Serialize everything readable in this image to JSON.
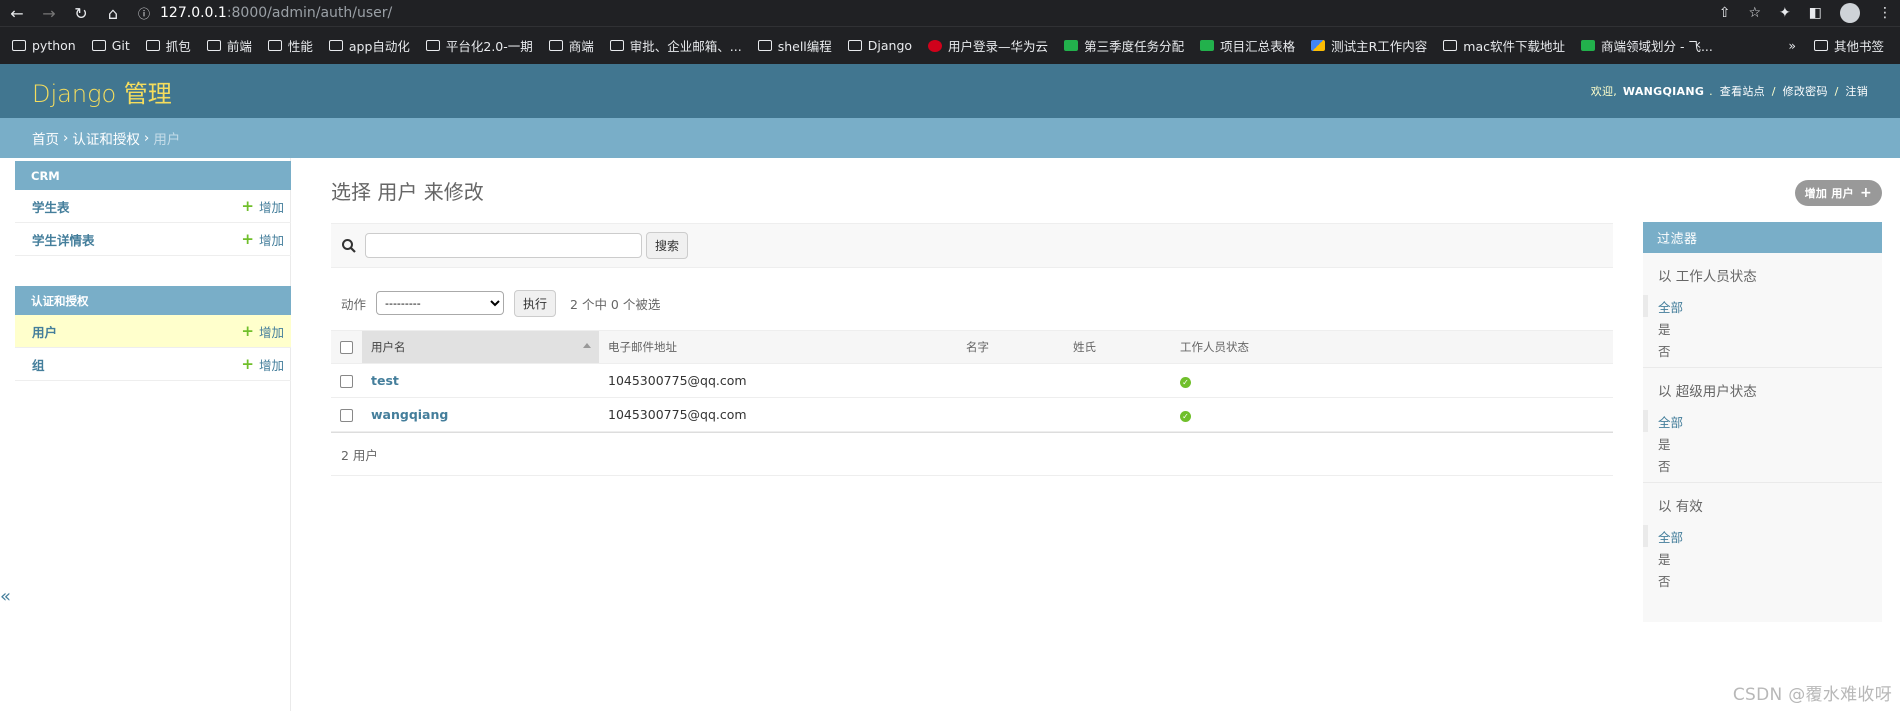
{
  "browser": {
    "url_host": "127.0.0.1",
    "url_path": ":8000/admin/auth/user/",
    "bookmarks": [
      {
        "label": "python",
        "icon": "folder"
      },
      {
        "label": "Git",
        "icon": "folder"
      },
      {
        "label": "抓包",
        "icon": "folder"
      },
      {
        "label": "前端",
        "icon": "folder"
      },
      {
        "label": "性能",
        "icon": "folder"
      },
      {
        "label": "app自动化",
        "icon": "folder"
      },
      {
        "label": "平台化2.0-一期",
        "icon": "folder"
      },
      {
        "label": "商端",
        "icon": "folder"
      },
      {
        "label": "审批、企业邮箱、...",
        "icon": "folder"
      },
      {
        "label": "shell编程",
        "icon": "folder"
      },
      {
        "label": "Django",
        "icon": "folder"
      },
      {
        "label": "用户登录—华为云",
        "icon": "huawei"
      },
      {
        "label": "第三季度任务分配",
        "icon": "sheet"
      },
      {
        "label": "项目汇总表格",
        "icon": "sheet"
      },
      {
        "label": "测试主R工作内容",
        "icon": "doc"
      },
      {
        "label": "mac软件下载地址",
        "icon": "folder"
      },
      {
        "label": "商端领域划分 - 飞...",
        "icon": "sheet"
      }
    ],
    "more_label": "»",
    "other_bookmarks": "其他书签"
  },
  "header": {
    "branding": "Django 管理",
    "welcome": "欢迎,",
    "username": "WANGQIANG",
    "view_site": "查看站点",
    "change_password": "修改密码",
    "logout": "注销"
  },
  "breadcrumbs": {
    "home": "首页",
    "app": "认证和授权",
    "current": "用户"
  },
  "sidebar": {
    "modules": [
      {
        "caption": "CRM",
        "rows": [
          {
            "label": "学生表",
            "add": "增加"
          },
          {
            "label": "学生详情表",
            "add": "增加"
          }
        ]
      },
      {
        "caption": "认证和授权",
        "rows": [
          {
            "label": "用户",
            "add": "增加"
          },
          {
            "label": "组",
            "add": "增加"
          }
        ]
      }
    ],
    "toggle": "«"
  },
  "content": {
    "title": "选择 用户 来修改",
    "add_button": "增加 用户",
    "search_button": "搜索",
    "search_value": "",
    "action_label": "动作",
    "action_select": "---------",
    "execute_button": "执行",
    "selected_count": "2 个中 0 个被选",
    "columns": [
      "用户名",
      "电子邮件地址",
      "名字",
      "姓氏",
      "工作人员状态"
    ],
    "rows": [
      {
        "username": "test",
        "email": "1045300775@qq.com",
        "first_name": "",
        "last_name": "",
        "is_staff": true
      },
      {
        "username": "wangqiang",
        "email": "1045300775@qq.com",
        "first_name": "",
        "last_name": "",
        "is_staff": true
      }
    ],
    "paginator": "2 用户"
  },
  "filter": {
    "title": "过滤器",
    "groups": [
      {
        "title": "以 工作人员状态",
        "options": [
          "全部",
          "是",
          "否"
        ]
      },
      {
        "title": "以 超级用户状态",
        "options": [
          "全部",
          "是",
          "否"
        ]
      },
      {
        "title": "以 有效",
        "options": [
          "全部",
          "是",
          "否"
        ]
      }
    ]
  },
  "watermark": "CSDN @覆水难收呀",
  "colors": {
    "header_bg": "#417690",
    "branding": "#f5dd5d",
    "breadcrumb_bg": "#79aec8",
    "link": "#447e9b",
    "add_plus": "#70bf2b",
    "current_row": "#ffffcc"
  }
}
